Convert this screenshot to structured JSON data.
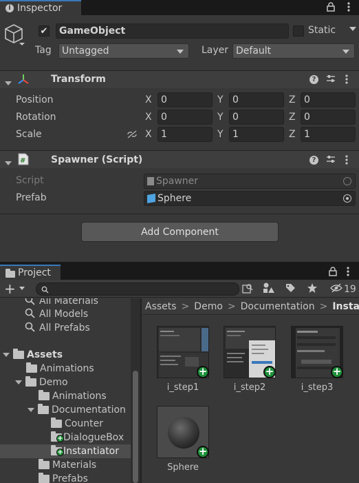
{
  "inspector": {
    "tab_title": "Inspector",
    "gameobject": {
      "name": "GameObject",
      "active": true,
      "static_label": "Static",
      "static_checked": false,
      "tag_label": "Tag",
      "tag_value": "Untagged",
      "layer_label": "Layer",
      "layer_value": "Default"
    },
    "transform": {
      "title": "Transform",
      "rows": [
        {
          "label": "Position",
          "x": "0",
          "y": "0",
          "z": "0"
        },
        {
          "label": "Rotation",
          "x": "0",
          "y": "0",
          "z": "0"
        },
        {
          "label": "Scale",
          "x": "1",
          "y": "1",
          "z": "1"
        }
      ],
      "axis_x": "X",
      "axis_y": "Y",
      "axis_z": "Z"
    },
    "spawner": {
      "title": "Spawner (Script)",
      "script_label": "Script",
      "script_value": "Spawner",
      "prefab_label": "Prefab",
      "prefab_value": "Sphere"
    },
    "add_component_label": "Add Component"
  },
  "project": {
    "tab_title": "Project",
    "hidden_count": "19",
    "search_value": "",
    "favorites": [
      "All Materials",
      "All Models",
      "All Prefabs"
    ],
    "tree": {
      "assets": "Assets",
      "animations": "Animations",
      "demo": "Demo",
      "demo_animations": "Animations",
      "documentation": "Documentation",
      "counter": "Counter",
      "dialoguebox": "DialogueBox",
      "instantiator": "Instantiator",
      "materials": "Materials",
      "prefabs": "Prefabs"
    },
    "breadcrumb": [
      "Assets",
      "Demo",
      "Documentation",
      "Instantiator"
    ],
    "assets": [
      {
        "name": "i_step1"
      },
      {
        "name": "i_step2"
      },
      {
        "name": "i_step3"
      },
      {
        "name": "Sphere"
      }
    ]
  },
  "colors": {
    "accent_blue": "#3a79bb",
    "panel_bg": "#383838",
    "field_bg": "#2a2a2a",
    "add_badge_green": "#1f8f3a",
    "selected_row": "#4d4d4d"
  }
}
